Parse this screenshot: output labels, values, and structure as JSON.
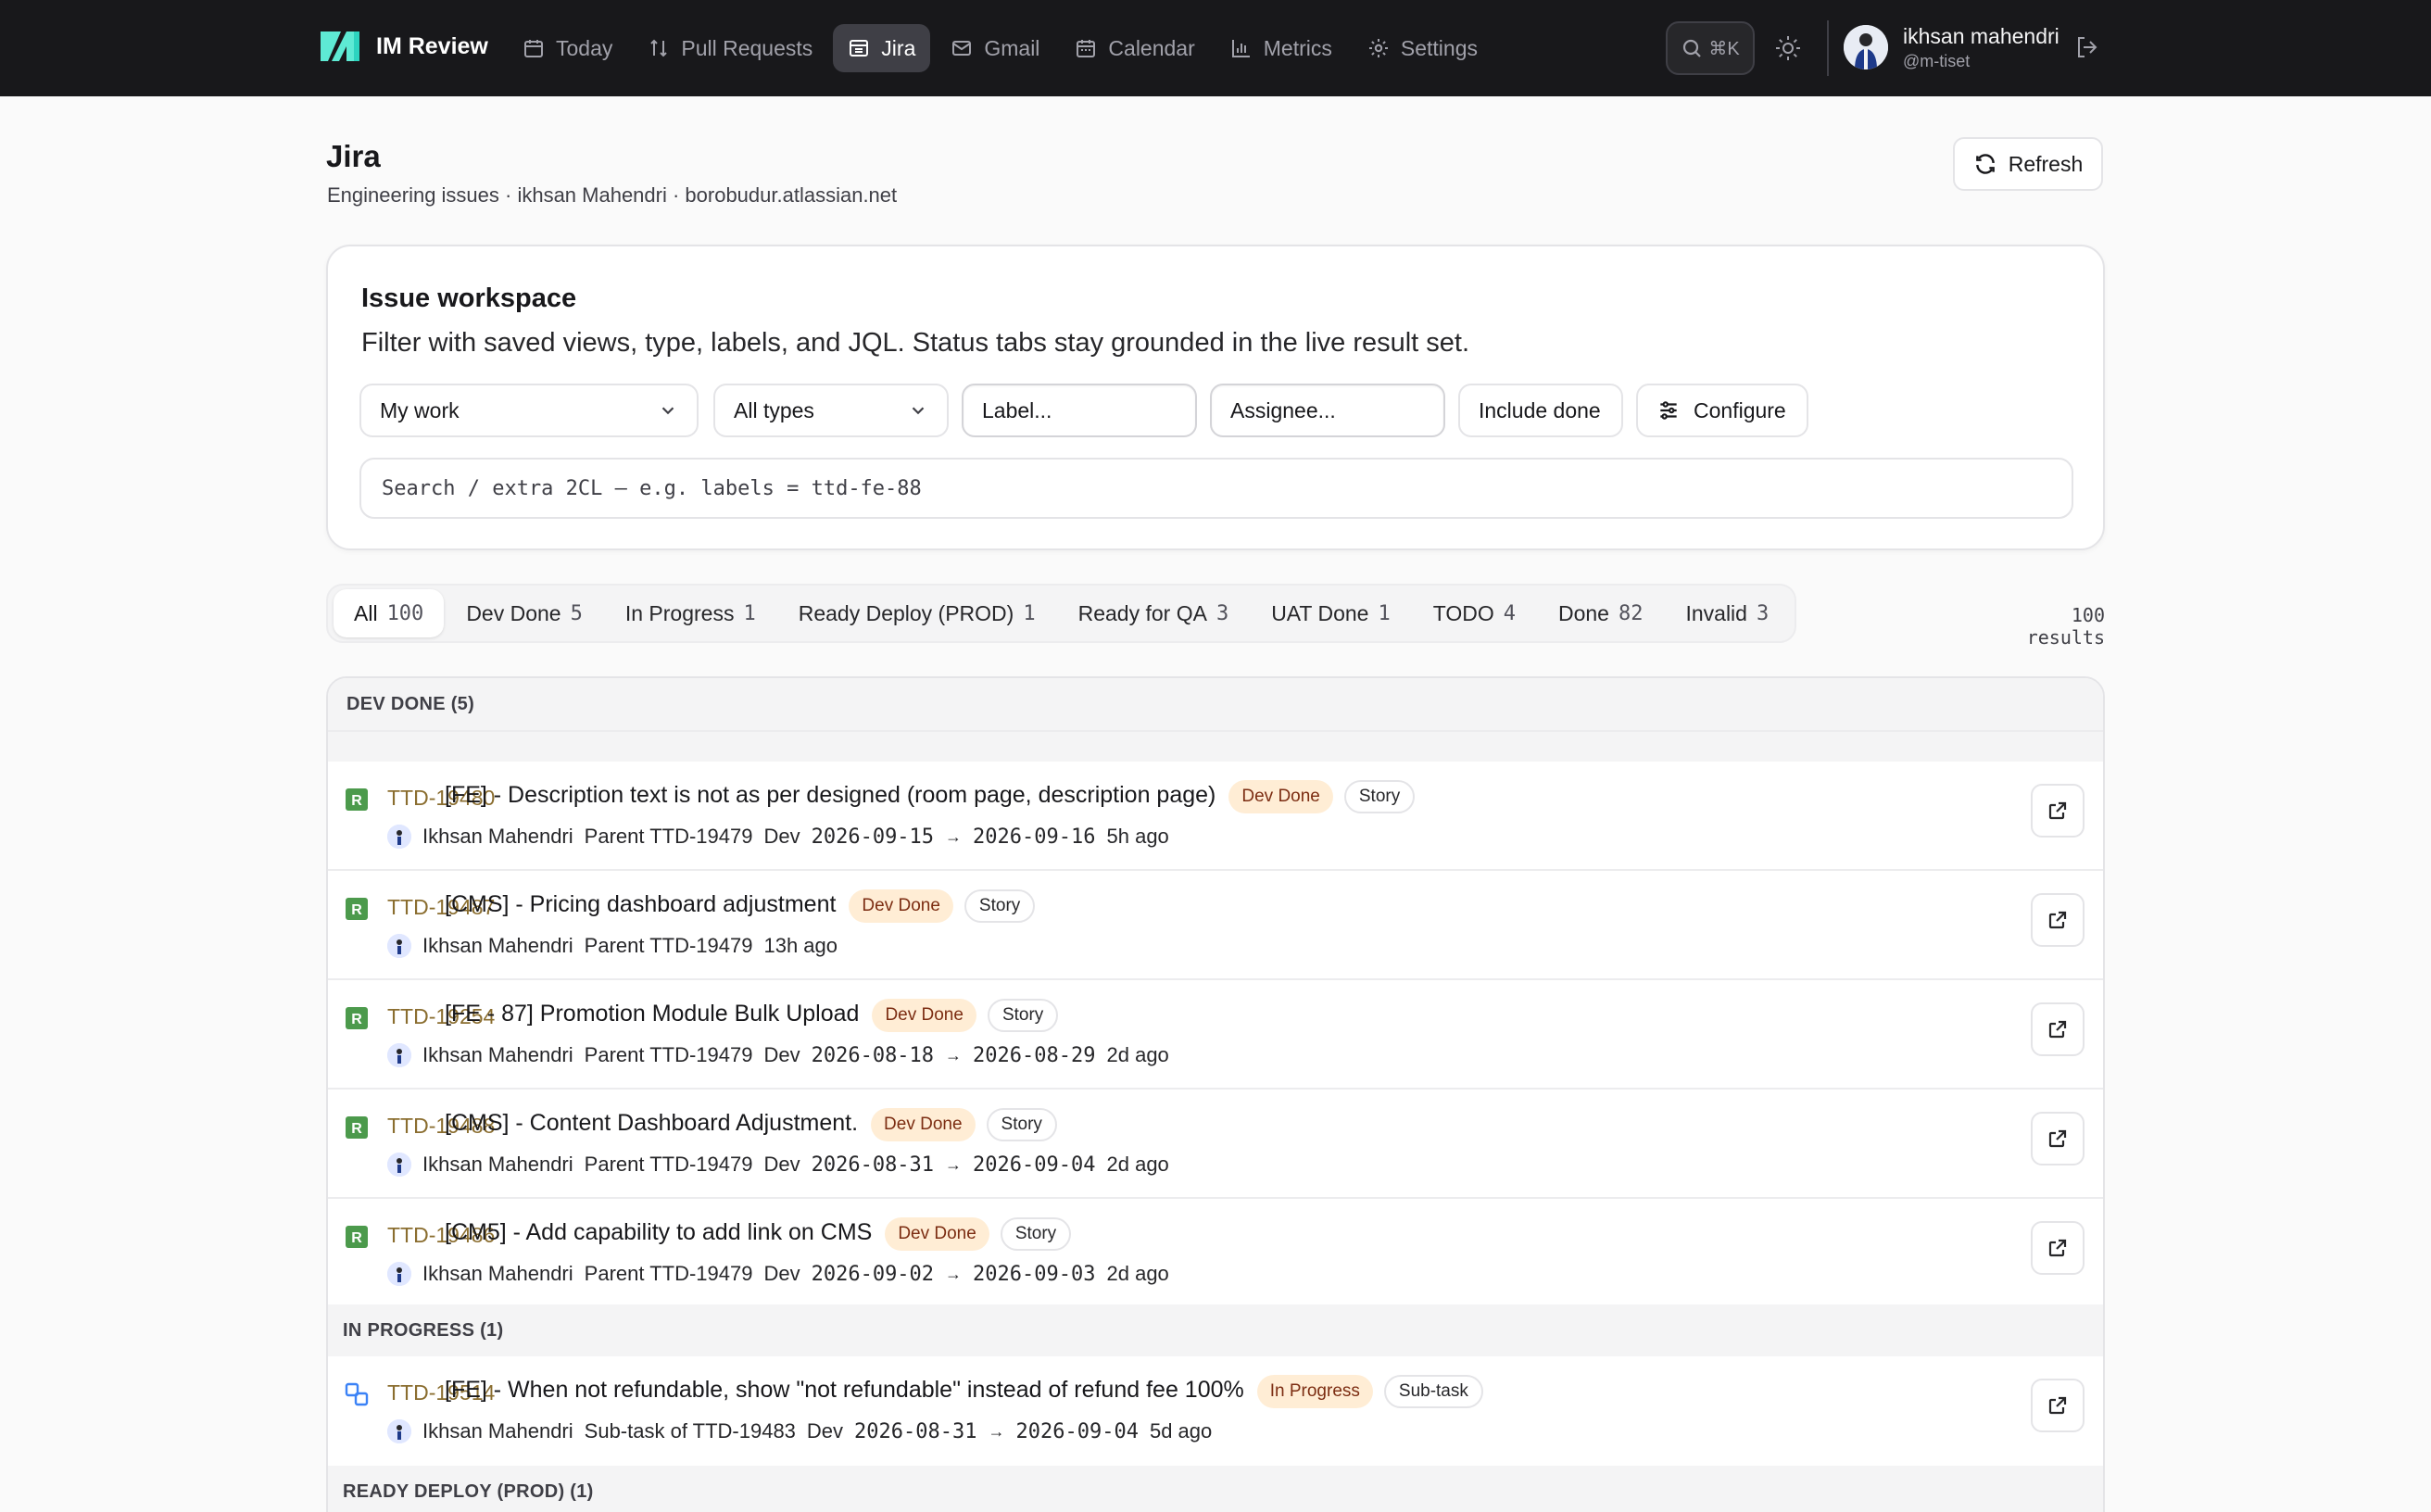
{
  "app": {
    "name": "IM Review",
    "nav": [
      {
        "label": "Today",
        "icon": "calendar-icon"
      },
      {
        "label": "Pull Requests",
        "icon": "pull-request-icon"
      },
      {
        "label": "Jira",
        "icon": "board-icon",
        "active": true
      },
      {
        "label": "Gmail",
        "icon": "mail-icon"
      },
      {
        "label": "Calendar",
        "icon": "calendar-icon"
      },
      {
        "label": "Metrics",
        "icon": "bar-chart-icon"
      },
      {
        "label": "Settings",
        "icon": "gear-icon"
      }
    ],
    "search_shortcut": "⌘K",
    "user": {
      "name": "ikhsan mahendri",
      "handle": "@m-tiset"
    }
  },
  "page": {
    "title": "Jira",
    "subtitle": "Engineering issues · ikhsan Mahendri · borobudur.atlassian.net",
    "refresh_label": "Refresh"
  },
  "workspace": {
    "title": "Issue workspace",
    "description": "Filter with saved views, type, labels, and JQL. Status tabs stay grounded in the live result set.",
    "view_select": "My work",
    "type_select": "All types",
    "label_placeholder": "Label...",
    "assignee_placeholder": "Assignee...",
    "include_done_label": "Include done",
    "configure_label": "Configure",
    "jql_placeholder": "Search / extra 2CL – e.g. labels = ttd-fe-88"
  },
  "tabs": [
    {
      "label": "All",
      "count": "100",
      "active": true
    },
    {
      "label": "Dev Done",
      "count": "5"
    },
    {
      "label": "In Progress",
      "count": "1"
    },
    {
      "label": "Ready Deploy (PROD)",
      "count": "1"
    },
    {
      "label": "Ready for QA",
      "count": "3"
    },
    {
      "label": "UAT Done",
      "count": "1"
    },
    {
      "label": "TODO",
      "count": "4"
    },
    {
      "label": "Done",
      "count": "82"
    },
    {
      "label": "Invalid",
      "count": "3"
    }
  ],
  "results_label": "100 results",
  "groups": {
    "dev_done": "DEV DONE (5)",
    "in_progress": "IN PROGRESS (1)",
    "ready_deploy": "READY DEPLOY (PROD) (1)"
  },
  "issues": [
    {
      "key": "TTD-19480",
      "title": "[FE] - Description text is not as per designed (room page, description page)",
      "status": "Dev Done",
      "type": "Story",
      "assignee": "Ikhsan Mahendri",
      "parent": "Parent TTD-19479",
      "dev": "Dev",
      "start": "2026-09-15",
      "arrow": "→",
      "end": "2026-09-16",
      "ago": "5h ago"
    },
    {
      "key": "TTD-19487",
      "title": "[CMS] - Pricing dashboard adjustment",
      "status": "Dev Done",
      "type": "Story",
      "assignee": "Ikhsan Mahendri",
      "parent": "Parent TTD-19479",
      "ago": "13h ago"
    },
    {
      "key": "TTD-19254",
      "title": "[FE - 87] Promotion Module Bulk Upload",
      "status": "Dev Done",
      "type": "Story",
      "assignee": "Ikhsan Mahendri",
      "parent": "Parent TTD-19479",
      "dev": "Dev",
      "start": "2026-08-18",
      "arrow": "→",
      "end": "2026-08-29",
      "ago": "2d ago"
    },
    {
      "key": "TTD-19488",
      "title": "[CMS] - Content Dashboard Adjustment.",
      "status": "Dev Done",
      "type": "Story",
      "assignee": "Ikhsan Mahendri",
      "parent": "Parent TTD-19479",
      "dev": "Dev",
      "start": "2026-08-31",
      "arrow": "→",
      "end": "2026-09-04",
      "ago": "2d ago"
    },
    {
      "key": "TTD-19486",
      "title": "[CM5] - Add capability to add link on CMS",
      "status": "Dev Done",
      "type": "Story",
      "assignee": "Ikhsan Mahendri",
      "parent": "Parent TTD-19479",
      "dev": "Dev",
      "start": "2026-09-02",
      "arrow": "→",
      "end": "2026-09-03",
      "ago": "2d ago"
    },
    {
      "key": "TTD-19514",
      "title": "[FE] - When not refundable, show \"not refundable\" instead of refund fee 100%",
      "status": "In Progress",
      "type": "Sub-task",
      "assignee": "Ikhsan Mahendri",
      "parent": "Sub-task of TTD-19483",
      "dev": "Dev",
      "start": "2026-08-31",
      "arrow": "→",
      "end": "2026-09-04",
      "ago": "5d ago"
    }
  ],
  "colors": {
    "accent_green": "#4c9a4c",
    "key_color": "#8a6d2f",
    "status_bg": "#ffedd5",
    "nav_bg": "#18181b"
  }
}
